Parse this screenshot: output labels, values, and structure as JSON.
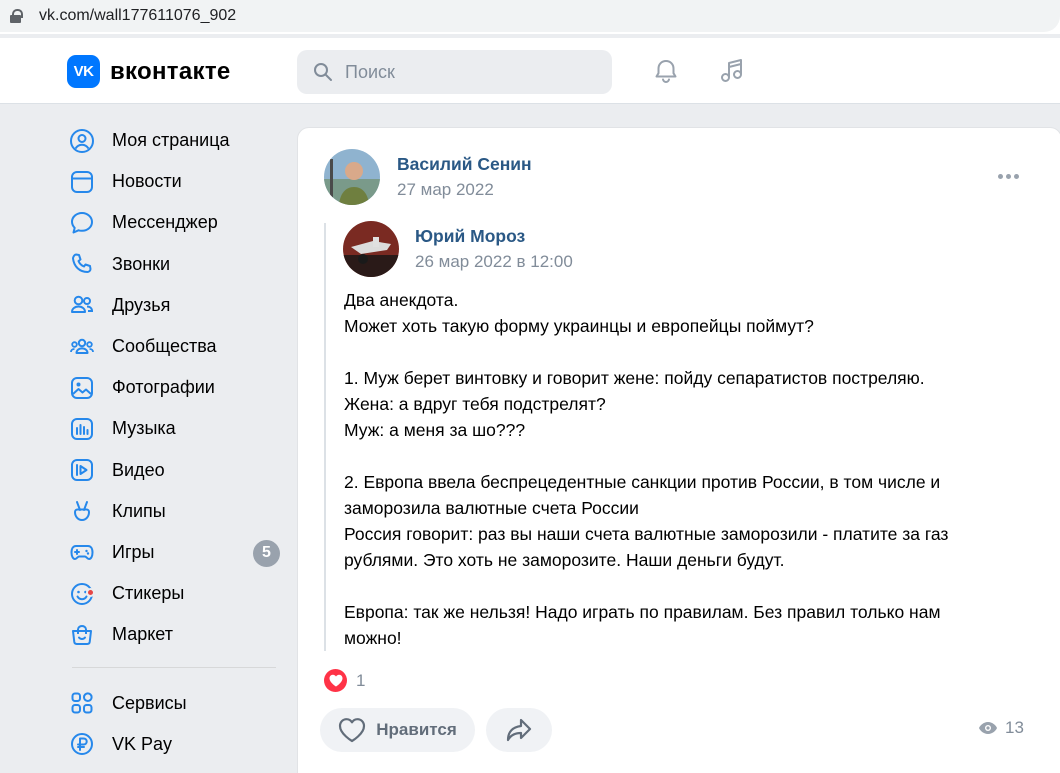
{
  "browser": {
    "url": "vk.com/wall177611076_902"
  },
  "header": {
    "logo_mark": "VK",
    "logo_text": "вконтакте",
    "search_placeholder": "Поиск"
  },
  "sidebar": {
    "items": [
      {
        "label": "Моя страница",
        "icon": "user-circle-icon"
      },
      {
        "label": "Новости",
        "icon": "newsfeed-icon"
      },
      {
        "label": "Мессенджер",
        "icon": "message-icon"
      },
      {
        "label": "Звонки",
        "icon": "phone-icon"
      },
      {
        "label": "Друзья",
        "icon": "friends-icon"
      },
      {
        "label": "Сообщества",
        "icon": "communities-icon"
      },
      {
        "label": "Фотографии",
        "icon": "photo-icon"
      },
      {
        "label": "Музыка",
        "icon": "music-icon"
      },
      {
        "label": "Видео",
        "icon": "video-icon"
      },
      {
        "label": "Клипы",
        "icon": "clips-icon"
      },
      {
        "label": "Игры",
        "icon": "gamepad-icon",
        "badge": "5"
      },
      {
        "label": "Стикеры",
        "icon": "sticker-icon"
      },
      {
        "label": "Маркет",
        "icon": "market-icon"
      }
    ],
    "secondary": [
      {
        "label": "Сервисы",
        "icon": "services-icon"
      },
      {
        "label": "VK Pay",
        "icon": "vkpay-icon"
      }
    ]
  },
  "post": {
    "author": "Василий Сенин",
    "date": "27 мар 2022",
    "repost": {
      "author": "Юрий Мороз",
      "date": "26 мар 2022 в 12:00",
      "text": "Два анекдота.\nМожет хоть такую форму украинцы и европейцы поймут?\n\n1. Муж берет винтовку и говорит жене: пойду сепаратистов постреляю.\nЖена: а вдруг тебя подстрелят?\nМуж: а меня за шо???\n\n2. Европа ввела беспрецедентные санкции против России, в том числе и заморозила валютные счета России\nРоссия говорит: раз вы наши счета валютные заморозили - платите за газ рублями. Это хоть не заморозите. Наши деньги будут.\n\nЕвропа: так же нельзя! Надо играть по правилам. Без правил только нам можно!"
    },
    "likes_count": "1",
    "like_label": "Нравится",
    "views_count": "13"
  },
  "colors": {
    "accent": "#0077ff",
    "link": "#2a5885",
    "nav_icon": "#2688eb",
    "like_red": "#ff3347",
    "secondary_text": "#818c99",
    "page_bg": "#ebedf0"
  }
}
